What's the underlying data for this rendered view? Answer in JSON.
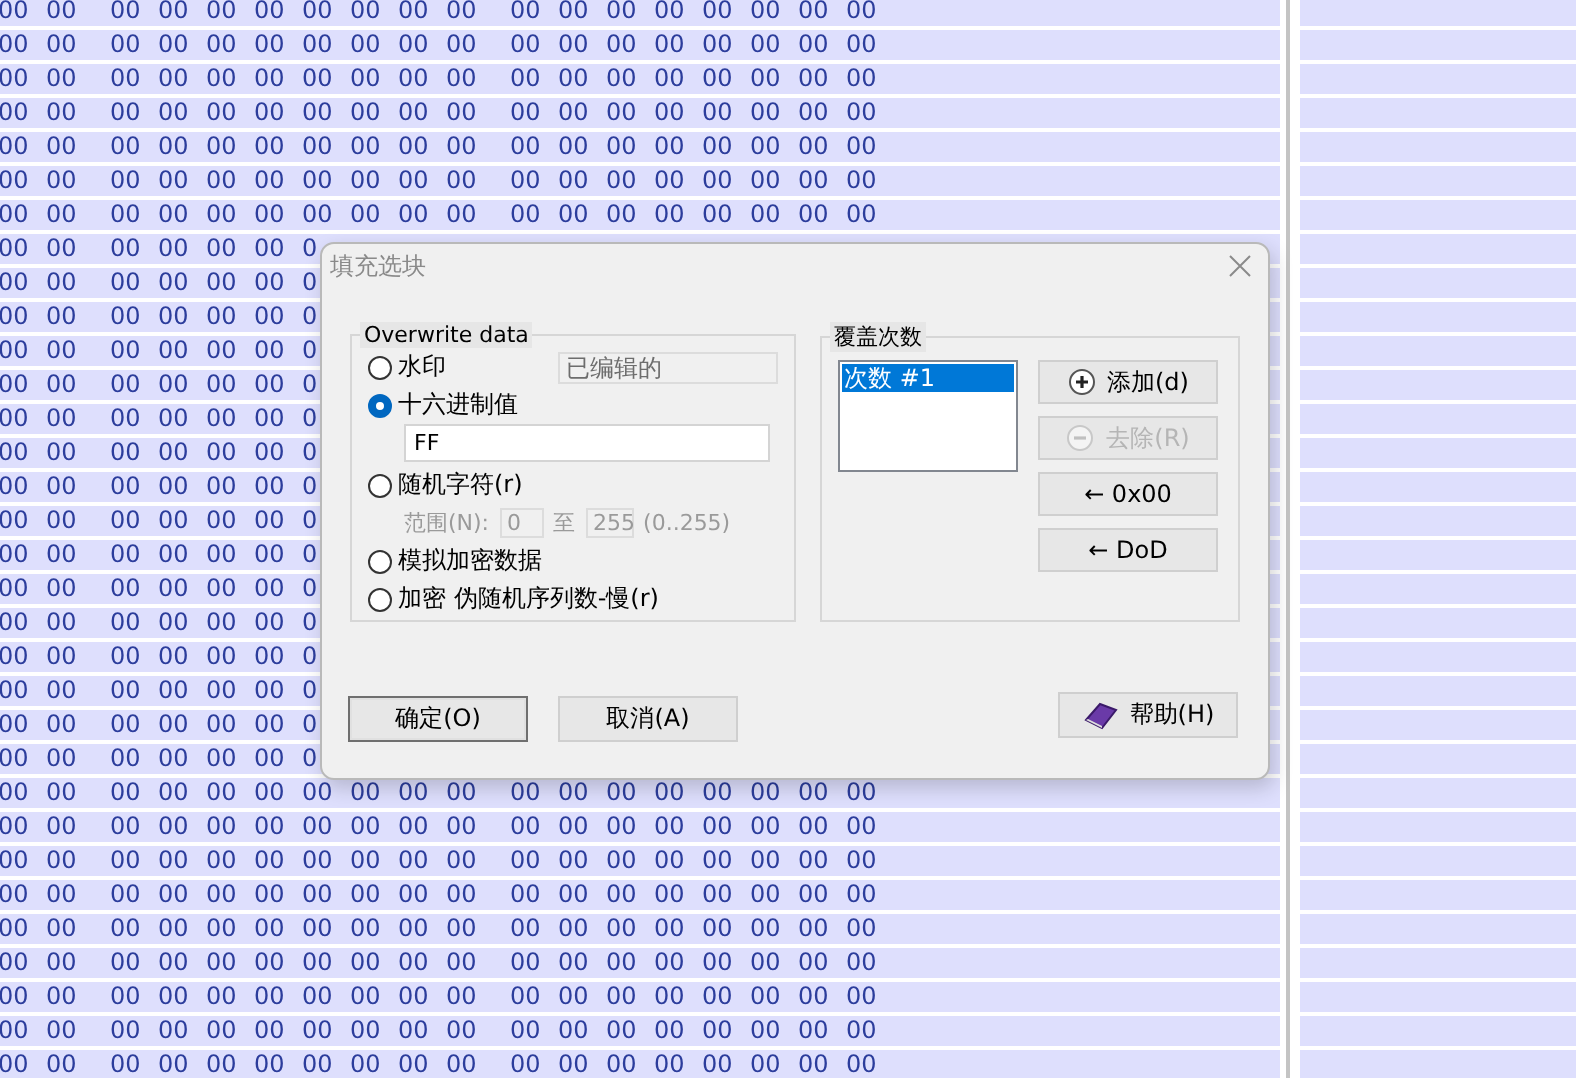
{
  "hex_rows": [
    {
      "cells": [
        "00",
        "00",
        "00",
        "00",
        "00",
        "00",
        "00",
        "00",
        "00",
        "00",
        "00",
        "00",
        "00",
        "00",
        "00",
        "00",
        "00",
        "00"
      ]
    },
    {
      "cells": [
        "00",
        "00",
        "00",
        "00",
        "00",
        "00",
        "00",
        "00",
        "00",
        "00",
        "00",
        "00",
        "00",
        "00",
        "00",
        "00",
        "00",
        "00"
      ]
    },
    {
      "cells": [
        "00",
        "00",
        "00",
        "00",
        "00",
        "00",
        "00",
        "00",
        "00",
        "00",
        "00",
        "00",
        "00",
        "00",
        "00",
        "00",
        "00",
        "00"
      ]
    },
    {
      "cells": [
        "00",
        "00",
        "00",
        "00",
        "00",
        "00",
        "00",
        "00",
        "00",
        "00",
        "00",
        "00",
        "00",
        "00",
        "00",
        "00",
        "00",
        "00"
      ]
    },
    {
      "cells": [
        "00",
        "00",
        "00",
        "00",
        "00",
        "00",
        "00",
        "00",
        "00",
        "00",
        "00",
        "00",
        "00",
        "00",
        "00",
        "00",
        "00",
        "00"
      ]
    },
    {
      "cells": [
        "00",
        "00",
        "00",
        "00",
        "00",
        "00",
        "00",
        "00",
        "00",
        "00",
        "00",
        "00",
        "00",
        "00",
        "00",
        "00",
        "00",
        "00"
      ]
    },
    {
      "cells": [
        "00",
        "00",
        "00",
        "00",
        "00",
        "00",
        "00",
        "00",
        "00",
        "00",
        "00",
        "00",
        "00",
        "00",
        "00",
        "00",
        "00",
        "00"
      ]
    },
    {
      "cells": [
        "00",
        "00",
        "00",
        "00",
        "00",
        "00",
        "0"
      ]
    },
    {
      "cells": [
        "00",
        "00",
        "00",
        "00",
        "00",
        "00",
        "0"
      ]
    },
    {
      "cells": [
        "00",
        "00",
        "00",
        "00",
        "00",
        "00",
        "0"
      ]
    },
    {
      "cells": [
        "00",
        "00",
        "00",
        "00",
        "00",
        "00",
        "0"
      ]
    },
    {
      "cells": [
        "00",
        "00",
        "00",
        "00",
        "00",
        "00",
        "0"
      ]
    },
    {
      "cells": [
        "00",
        "00",
        "00",
        "00",
        "00",
        "00",
        "0"
      ]
    },
    {
      "cells": [
        "00",
        "00",
        "00",
        "00",
        "00",
        "00",
        "0"
      ]
    },
    {
      "cells": [
        "00",
        "00",
        "00",
        "00",
        "00",
        "00",
        "0"
      ]
    },
    {
      "cells": [
        "00",
        "00",
        "00",
        "00",
        "00",
        "00",
        "0"
      ]
    },
    {
      "cells": [
        "00",
        "00",
        "00",
        "00",
        "00",
        "00",
        "0"
      ]
    },
    {
      "cells": [
        "00",
        "00",
        "00",
        "00",
        "00",
        "00",
        "0"
      ]
    },
    {
      "cells": [
        "00",
        "00",
        "00",
        "00",
        "00",
        "00",
        "0"
      ]
    },
    {
      "cells": [
        "00",
        "00",
        "00",
        "00",
        "00",
        "00",
        "0"
      ]
    },
    {
      "cells": [
        "00",
        "00",
        "00",
        "00",
        "00",
        "00",
        "0"
      ]
    },
    {
      "cells": [
        "00",
        "00",
        "00",
        "00",
        "00",
        "00",
        "0"
      ]
    },
    {
      "cells": [
        "00",
        "00",
        "00",
        "00",
        "00",
        "00",
        "0"
      ]
    },
    {
      "cells": [
        "00",
        "00",
        "00",
        "00",
        "00",
        "00",
        "00",
        "00",
        "00",
        "00",
        "00",
        "00",
        "00",
        "00",
        "00",
        "00",
        "00",
        "00"
      ]
    },
    {
      "cells": [
        "00",
        "00",
        "00",
        "00",
        "00",
        "00",
        "00",
        "00",
        "00",
        "00",
        "00",
        "00",
        "00",
        "00",
        "00",
        "00",
        "00",
        "00"
      ]
    },
    {
      "cells": [
        "00",
        "00",
        "00",
        "00",
        "00",
        "00",
        "00",
        "00",
        "00",
        "00",
        "00",
        "00",
        "00",
        "00",
        "00",
        "00",
        "00",
        "00"
      ]
    },
    {
      "cells": [
        "00",
        "00",
        "00",
        "00",
        "00",
        "00",
        "00",
        "00",
        "00",
        "00",
        "00",
        "00",
        "00",
        "00",
        "00",
        "00",
        "00",
        "00"
      ]
    },
    {
      "cells": [
        "00",
        "00",
        "00",
        "00",
        "00",
        "00",
        "00",
        "00",
        "00",
        "00",
        "00",
        "00",
        "00",
        "00",
        "00",
        "00",
        "00",
        "00"
      ]
    },
    {
      "cells": [
        "00",
        "00",
        "00",
        "00",
        "00",
        "00",
        "00",
        "00",
        "00",
        "00",
        "00",
        "00",
        "00",
        "00",
        "00",
        "00",
        "00",
        "00"
      ]
    },
    {
      "cells": [
        "00",
        "00",
        "00",
        "00",
        "00",
        "00",
        "00",
        "00",
        "00",
        "00",
        "00",
        "00",
        "00",
        "00",
        "00",
        "00",
        "00",
        "00"
      ]
    },
    {
      "cells": [
        "00",
        "00",
        "00",
        "00",
        "00",
        "00",
        "00",
        "00",
        "00",
        "00",
        "00",
        "00",
        "00",
        "00",
        "00",
        "00",
        "00",
        "00"
      ]
    },
    {
      "cells": [
        "00",
        "00",
        "00",
        "00",
        "00",
        "00",
        "00",
        "00",
        "00",
        "00",
        "00",
        "00",
        "00",
        "00",
        "00",
        "00",
        "00",
        "00"
      ]
    }
  ],
  "dialog": {
    "title": "填充选块",
    "overwrite": {
      "legend": "Overwrite data",
      "options": [
        {
          "kind": "field",
          "label": "水印",
          "selected": false,
          "field": {
            "value": "已编辑的",
            "disabled": true
          }
        },
        {
          "kind": "input",
          "label": "十六进制值",
          "selected": true,
          "value": "FF"
        },
        {
          "kind": "range",
          "label": "随机字符(r)",
          "selected": false,
          "range": {
            "label": "范围(N):",
            "from": "0",
            "to_label": "至",
            "to": "255",
            "hint": "(0..255)",
            "disabled": true
          }
        },
        {
          "kind": "plain",
          "label": "模拟加密数据",
          "selected": false
        },
        {
          "kind": "plain",
          "label": "加密 伪随机序列数-慢(r)",
          "selected": false
        }
      ]
    },
    "passes": {
      "legend": "覆盖次数",
      "items": [
        {
          "label": "次数 #1",
          "selected": true
        }
      ],
      "buttons": [
        {
          "kind": "add",
          "label": "添加(d)",
          "disabled": false
        },
        {
          "kind": "remove",
          "label": "去除(R)",
          "disabled": true
        },
        {
          "kind": "text",
          "label": "← 0x00",
          "disabled": false
        },
        {
          "kind": "text",
          "label": "← DoD",
          "disabled": false
        }
      ]
    },
    "footer": [
      {
        "kind": "text",
        "label": "确定(O)",
        "default": true
      },
      {
        "kind": "text",
        "label": "取消(A)",
        "default": false
      },
      {
        "kind": "help",
        "label": "帮助(H)",
        "default": false
      }
    ]
  }
}
